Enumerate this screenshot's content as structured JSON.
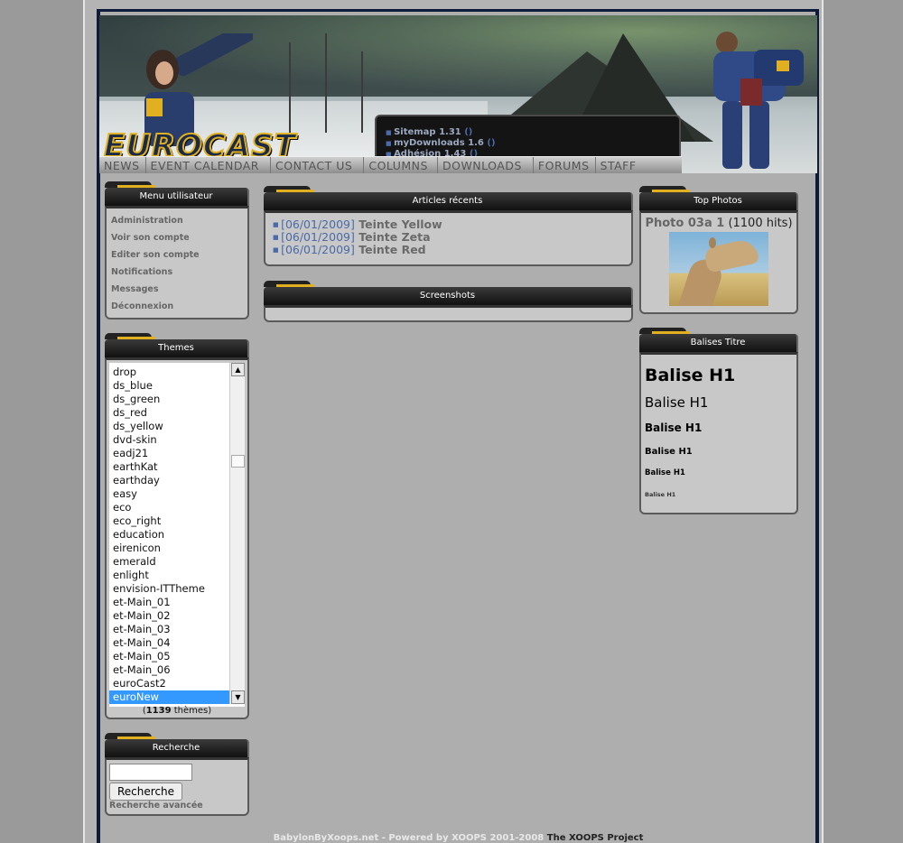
{
  "header": {
    "logo": "EUROCAST",
    "news": [
      {
        "label": "Sitemap 1.31",
        "suffix": "()"
      },
      {
        "label": "myDownloads 1.6",
        "suffix": "()"
      },
      {
        "label": "Adhésion 1.43",
        "suffix": "()"
      }
    ],
    "nav": [
      "NEWS",
      "EVENT CALENDAR",
      "CONTACT US",
      "COLUMNS",
      "DOWNLOADS",
      "FORUMS",
      "STAFF"
    ]
  },
  "user_menu": {
    "title": "Menu utilisateur",
    "items": [
      "Administration",
      "Voir son compte",
      "Editer son compte",
      "Notifications",
      "Messages",
      "Déconnexion"
    ]
  },
  "themes": {
    "title": "Themes",
    "items": [
      "drop",
      "ds_blue",
      "ds_green",
      "ds_red",
      "ds_yellow",
      "dvd-skin",
      "eadj21",
      "earthKat",
      "earthday",
      "easy",
      "eco",
      "eco_right",
      "education",
      "eirenicon",
      "emerald",
      "enlight",
      "envision-ITTheme",
      "et-Main_01",
      "et-Main_02",
      "et-Main_03",
      "et-Main_04",
      "et-Main_05",
      "et-Main_06",
      "euroCast2",
      "euroNew"
    ],
    "selected": "euroNew",
    "count": "1139",
    "count_suffix": " thèmes)",
    "count_prefix": "("
  },
  "search": {
    "title": "Recherche",
    "button": "Recherche",
    "advanced": "Recherche avancée"
  },
  "articles": {
    "title": "Articles récents",
    "items": [
      {
        "date": "[06/01/2009]",
        "title": "Teinte Yellow"
      },
      {
        "date": "[06/01/2009]",
        "title": "Teinte Zeta"
      },
      {
        "date": "[06/01/2009]",
        "title": "Teinte Red"
      }
    ]
  },
  "screenshots": {
    "title": "Screenshots"
  },
  "top_photos": {
    "title": "Top Photos",
    "photo_name": "Photo 03a 1",
    "hits": "(1100 hits)"
  },
  "balises": {
    "title": "Balises Titre",
    "items": [
      "Balise H1",
      "Balise H1",
      "Balise H1",
      "Balise H1",
      "Balise H1",
      "Balise H1"
    ]
  },
  "footer": {
    "text": "BabylonByXoops.net - Powered by XOOPS 2001-2008",
    "project": "The XOOPS Project"
  }
}
